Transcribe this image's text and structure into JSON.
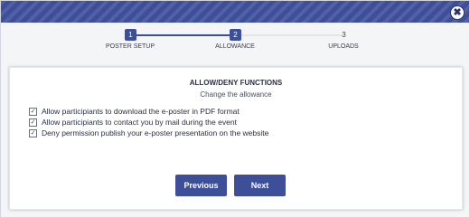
{
  "window": {
    "close_icon": "close-icon",
    "close_glyph": "✖"
  },
  "stepper": {
    "steps": [
      {
        "number": "1",
        "label": "POSTER SETUP",
        "state": "done"
      },
      {
        "number": "2",
        "label": "ALLOWANCE",
        "state": "current"
      },
      {
        "number": "3",
        "label": "UPLOADS",
        "state": "pending"
      }
    ]
  },
  "panel": {
    "title": "ALLOW/DENY FUNCTIONS",
    "subtitle": "Change the allowance",
    "options": [
      {
        "label": "Allow participiants to download the e-poster in PDF format",
        "checked": true
      },
      {
        "label": "Allow participiants to contact you by mail during the event",
        "checked": true
      },
      {
        "label": "Deny permission publish your e-poster presentation on the website",
        "checked": true
      }
    ],
    "check_glyph": "✓"
  },
  "actions": {
    "previous_label": "Previous",
    "next_label": "Next"
  },
  "colors": {
    "accent": "#3e4f9a",
    "background": "#f4f5f7"
  }
}
